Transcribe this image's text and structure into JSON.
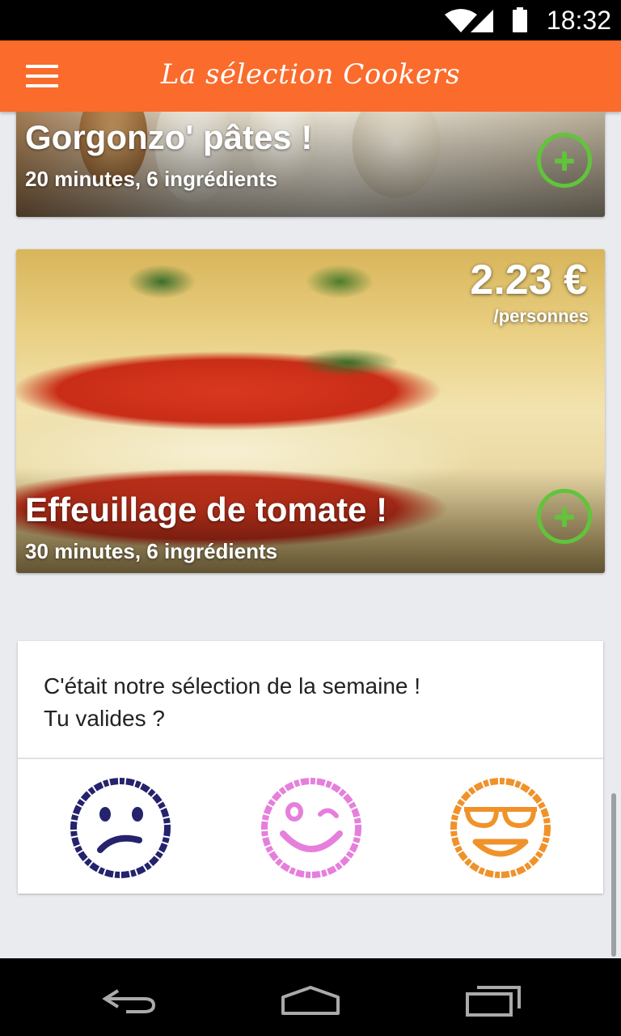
{
  "status_bar": {
    "time": "18:32",
    "icons": [
      "wifi-icon",
      "signal-icon",
      "battery-icon"
    ]
  },
  "app_bar": {
    "title": "La sélection Cookers",
    "menu_icon": "menu-icon"
  },
  "recipes": [
    {
      "title": "Gorgonzo' pâtes !",
      "details": "20 minutes, 6 ingrédients",
      "add_icon": "add-icon"
    },
    {
      "title": "Effeuillage de tomate !",
      "details": "30 minutes, 6 ingrédients",
      "price": "2.23 €",
      "price_unit": "/personnes",
      "add_icon": "add-icon"
    }
  ],
  "feedback": {
    "line1": "C'était notre sélection de la semaine !",
    "line2": "Tu valides ?",
    "options": [
      {
        "icon": "sad-face-icon",
        "color": "#25226e"
      },
      {
        "icon": "winking-face-icon",
        "color": "#e67fdc"
      },
      {
        "icon": "cool-face-icon",
        "color": "#f0922a"
      }
    ]
  },
  "nav_bar": {
    "icons": [
      "back-icon",
      "home-icon",
      "recent-apps-icon"
    ]
  },
  "colors": {
    "accent": "#fb6b2b",
    "add_button": "#61c43a"
  }
}
